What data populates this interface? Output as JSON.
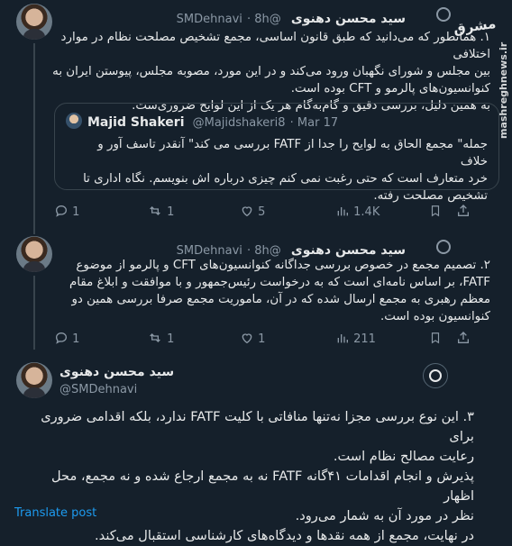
{
  "watermark": {
    "logo_text": "مشرق",
    "site": "mashreghnews.ir"
  },
  "tweets": [
    {
      "name": "سید محسن دهنوی",
      "handle": "@SMDehnavi",
      "time": "· 8h",
      "text_lines": [
        "۱. همانطور که می‌دانید که طبق قانون اساسی، مجمع تشخیص مصلحت نظام در موارد اختلافی",
        "بین مجلس و شورای نگهبان ورود می‌کند و در این مورد، مصوبه مجلس، پیوستن ایران به",
        "کنوانسیون‌های پالرمو و CFT بوده است.",
        "به همین دلیل، بررسی دقیق و گام‌به‌گام هر یک از این لوایح ضروری‌ست."
      ],
      "quote": {
        "name": "Majid Shakeri",
        "handle": "@Majidshakeri8",
        "time": "· Mar 17",
        "text_lines": [
          "جمله\" مجمع الحاق به لوایح را جدا از FATF بررسی می کند\" آنقدر تاسف آور و خلاف",
          "خرد متعارف است که حتی رغبت نمی کنم چیزی درباره اش بنویسم. نگاه اداری تا",
          "تشخیص مصلحت رفته."
        ]
      },
      "stats": {
        "replies": "1",
        "reposts": "1",
        "likes": "5",
        "views": "1.4K"
      }
    },
    {
      "name": "سید محسن دهنوی",
      "handle": "@SMDehnavi",
      "time": "· 8h",
      "text_lines": [
        "۲. تصمیم مجمع در خصوص بررسی جداگانه کنوانسیون‌های CFT و پالرمو از موضوع",
        "FATF، بر اساس نامه‌ای است که به درخواست رئیس‌جمهور و با موافقت و ابلاغ مقام",
        "معظم رهبری به مجمع ارسال شده که در آن، ماموریت مجمع صرفا بررسی همین دو",
        "کنوانسیون بوده است."
      ],
      "stats": {
        "replies": "1",
        "reposts": "1",
        "likes": "1",
        "views": "211"
      }
    },
    {
      "name": "سید محسن دهنوی",
      "handle": "@SMDehnavi",
      "text_lines": [
        "۳. این نوع بررسی مجزا نه‌تنها منافاتی با کلیت FATF ندارد، بلکه اقدامی ضروری برای",
        "رعایت مصالح نظام است.",
        "پذیرش و انجام اقدامات ۴۱گانه FATF نه به مجمع ارجاع شده و نه مجمع، محل اظهار",
        "نظر در مورد آن به شمار می‌رود.",
        "در نهایت، مجمع از همه نقدها و دیدگاه‌های کارشناسی استقبال می‌کند."
      ],
      "translate": "Translate post"
    }
  ]
}
